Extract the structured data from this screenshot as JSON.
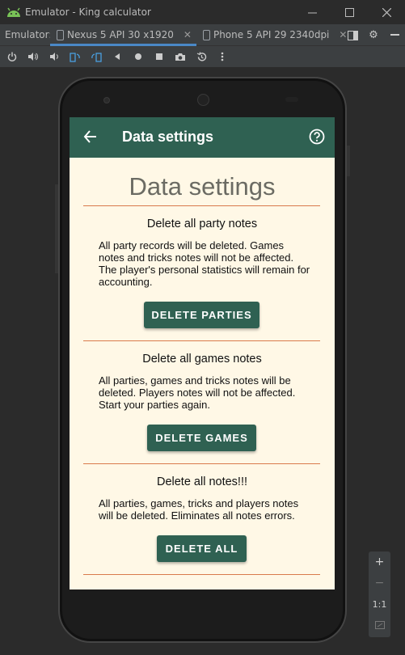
{
  "window": {
    "title": "Emulator - King calculator",
    "controls": [
      "minimize",
      "maximize",
      "close"
    ]
  },
  "tabs": {
    "label": "Emulator:",
    "items": [
      {
        "label": "Nexus 5 API 30 x1920",
        "active": true
      },
      {
        "label": "Phone 5 API 29 2340dpi",
        "active": false
      }
    ]
  },
  "toolbar": {
    "icons": [
      "power-icon",
      "volume-up-icon",
      "volume-down-icon",
      "rotate-left-icon",
      "rotate-right-icon",
      "back-icon",
      "home-icon",
      "overview-icon",
      "screenshot-icon",
      "snapshot-icon",
      "more-icon"
    ]
  },
  "app": {
    "appbar_title": "Data settings",
    "heading": "Data settings",
    "sections": [
      {
        "title": "Delete all party notes",
        "body": "All party records will be deleted. Games notes and tricks notes will not be affected. The player's personal statistics will remain for accounting.",
        "button": "DELETE PARTIES"
      },
      {
        "title": "Delete all games notes",
        "body": "All parties, games and tricks notes will be deleted. Players notes will not be affected. Start your parties again.",
        "button": "DELETE GAMES"
      },
      {
        "title": "Delete all notes!!!",
        "body": "All parties, games, tricks and players notes will be deleted. Eliminates all notes errors.",
        "button": "DELETE ALL"
      }
    ]
  },
  "zoom": {
    "plus": "+",
    "minus": "−",
    "one_to_one": "1:1"
  },
  "colors": {
    "appbar": "#2f6152",
    "screen_bg": "#fff8e6",
    "divider": "#d97a4c",
    "tab_active_indicator": "#4a88c7"
  }
}
